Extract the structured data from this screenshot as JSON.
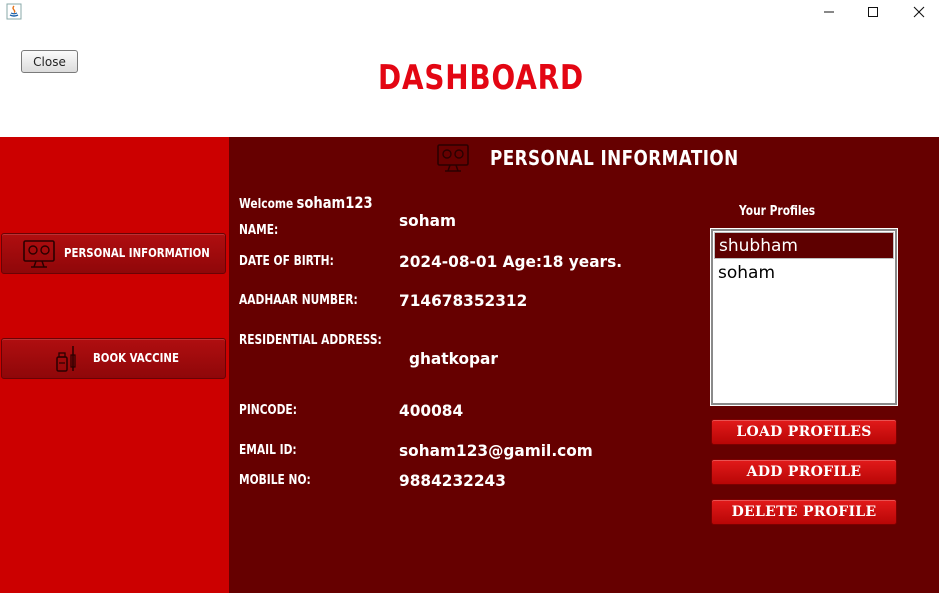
{
  "header": {
    "close_label": "Close",
    "title": "DASHBOARD"
  },
  "sidebar": {
    "items": [
      {
        "label": "PERSONAL INFORMATION",
        "icon": "monitor-profile-icon"
      },
      {
        "label": "BOOK VACCINE",
        "icon": "vaccine-bottle-icon"
      }
    ]
  },
  "main": {
    "section_title": "PERSONAL INFORMATION",
    "welcome_label": "Welcome",
    "welcome_user": "soham123",
    "fields": {
      "name_label": "NAME:",
      "name_value": "soham",
      "dob_label": "DATE OF BIRTH:",
      "dob_value": "2024-08-01 Age:18 years.",
      "aadhaar_label": "AADHAAR NUMBER:",
      "aadhaar_value": "714678352312",
      "address_label": "RESIDENTIAL ADDRESS:",
      "address_value": "ghatkopar",
      "pincode_label": "PINCODE:",
      "pincode_value": "400084",
      "email_label": "EMAIL ID:",
      "email_value": "soham123@gamil.com",
      "mobile_label": "MOBILE NO:",
      "mobile_value": "9884232243"
    },
    "profiles": {
      "title": "Your Profiles",
      "items": [
        "shubham",
        "soham"
      ],
      "selected_index": 0
    },
    "actions": {
      "load": "LOAD PROFILES",
      "add": "ADD PROFILE",
      "delete": "DELETE PROFILE"
    }
  },
  "colors": {
    "title_red": "#e30613",
    "sidebar_red": "#cc0000",
    "panel_dark_red": "#660000",
    "button_red": "#d41010"
  }
}
